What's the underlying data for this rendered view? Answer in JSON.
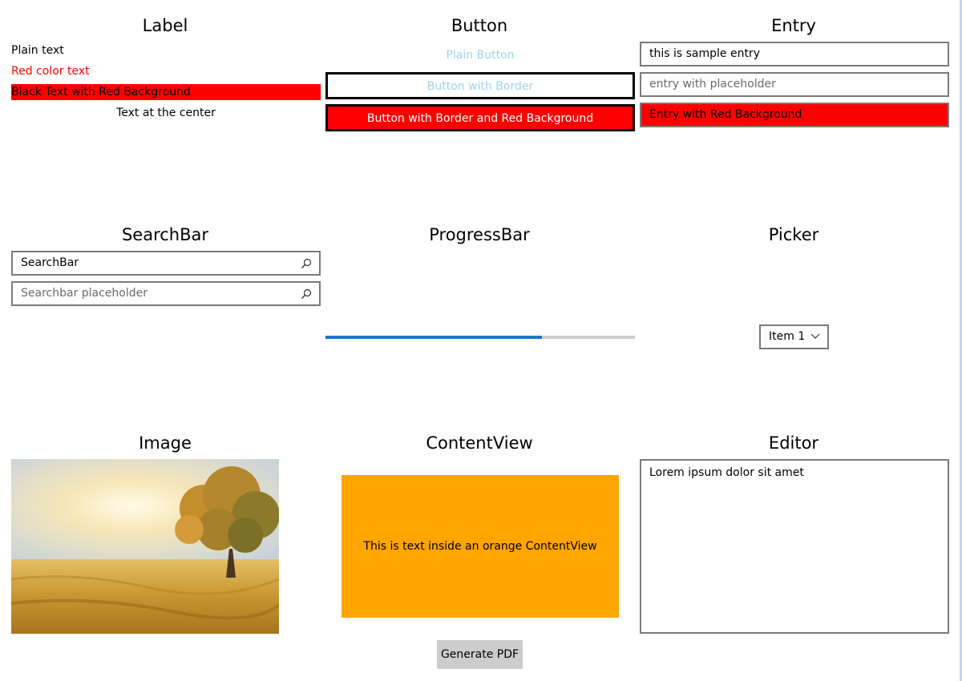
{
  "colors": {
    "red": "#ff0000",
    "orange": "#ffa500",
    "progress_fill": "#1a78c8",
    "progress_track": "#cccccc",
    "plain_button_text": "#9fd3e8",
    "placeholder_text": "#6b6b6b"
  },
  "label_section": {
    "heading": "Label",
    "plain": "Plain text",
    "red": "Red color text",
    "red_background": "Black Text with Red Background",
    "center": "Text at the center"
  },
  "button_section": {
    "heading": "Button",
    "plain": "Plain Button",
    "bordered": "Button with Border",
    "bordered_red": "Button with Border and Red Background"
  },
  "entry_section": {
    "heading": "Entry",
    "value": "this is sample entry",
    "placeholder": "entry with placeholder",
    "red_value": "Entry with Red Background"
  },
  "searchbar_section": {
    "heading": "SearchBar",
    "value": "SearchBar",
    "placeholder": "Searchbar placeholder",
    "icon": "search-icon"
  },
  "progressbar_section": {
    "heading": "ProgressBar",
    "progress": 0.7
  },
  "picker_section": {
    "heading": "Picker",
    "selected": "Item 1",
    "icon": "chevron-down-icon"
  },
  "image_section": {
    "heading": "Image"
  },
  "contentview_section": {
    "heading": "ContentView",
    "text": "This is text inside an orange ContentView"
  },
  "editor_section": {
    "heading": "Editor",
    "text": "Lorem ipsum dolor sit amet"
  },
  "footer": {
    "generate_pdf": "Generate PDF"
  }
}
